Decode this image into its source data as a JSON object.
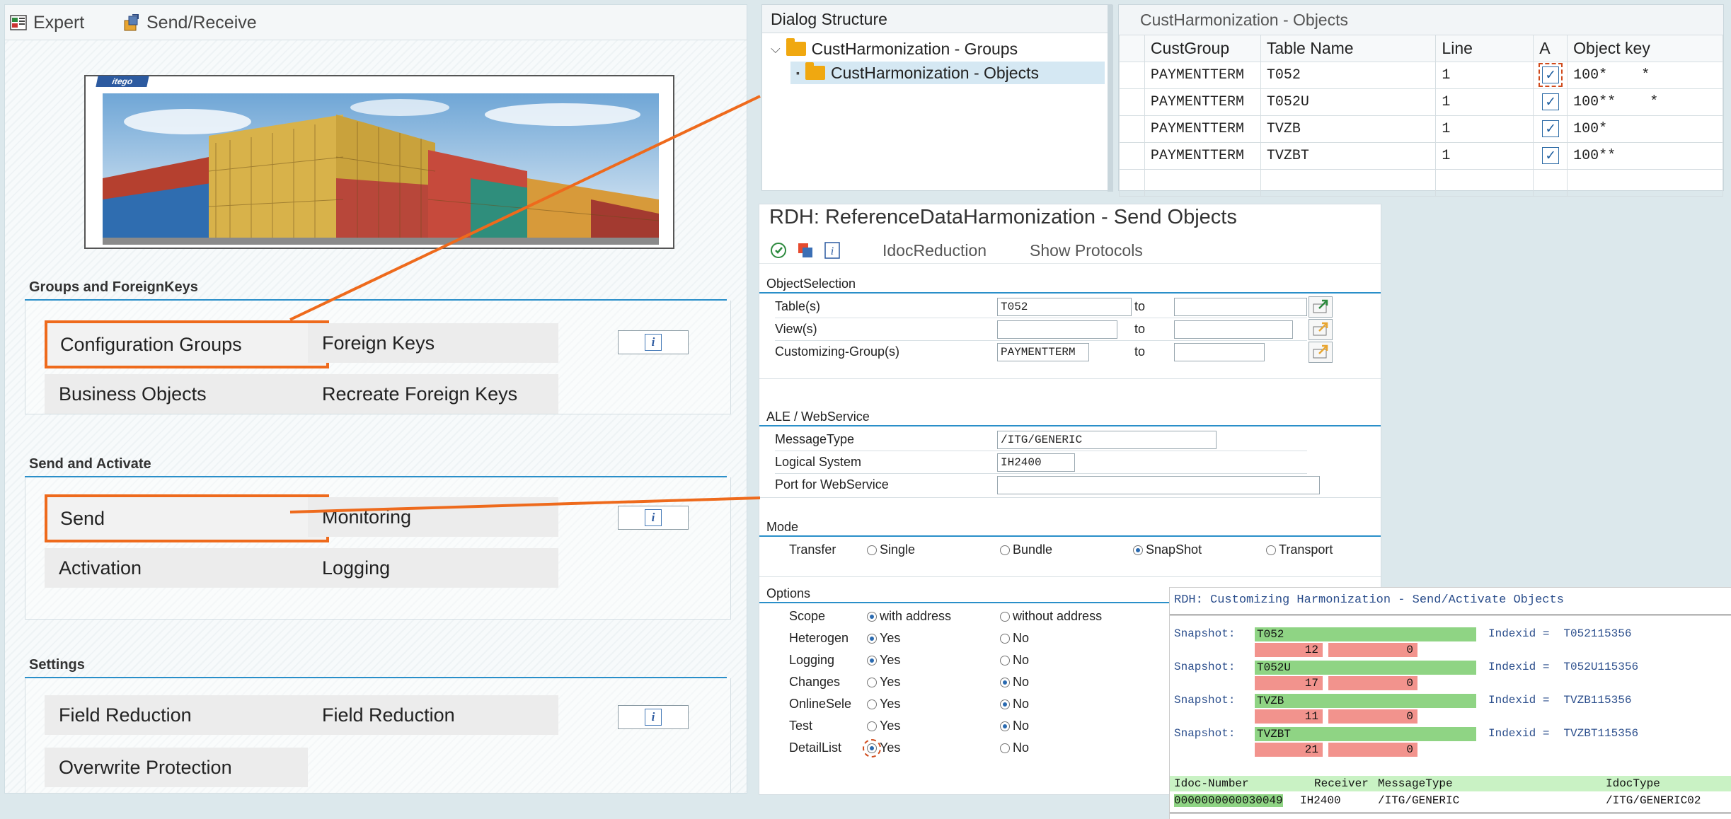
{
  "left_toolbar": {
    "expert": "Expert",
    "send_receive": "Send/Receive"
  },
  "banner": {
    "logo": "itego"
  },
  "groups_section": {
    "title": "Groups and ForeignKeys",
    "tiles": [
      "Configuration Groups",
      "Foreign Keys",
      "Business Objects",
      "Recreate Foreign Keys"
    ],
    "info": "i"
  },
  "send_section": {
    "title": "Send and Activate",
    "tiles": [
      "Send",
      "Monitoring",
      "Activation",
      "Logging"
    ],
    "info": "i"
  },
  "settings_section": {
    "title": "Settings",
    "tiles": [
      "Field Reduction",
      "Field Reduction",
      "Overwrite Protection"
    ],
    "info": "i"
  },
  "dialog_structure": {
    "title": "Dialog Structure",
    "items": [
      "CustHarmonization - Groups",
      "CustHarmonization - Objects"
    ]
  },
  "objects_table": {
    "title": "CustHarmonization - Objects",
    "columns": [
      "CustGroup",
      "Table Name",
      "Line",
      "A",
      "Object key"
    ],
    "rows": [
      {
        "group": "PAYMENTTERM",
        "table": "T052",
        "line": "1",
        "a": "✓",
        "key": "100*    *"
      },
      {
        "group": "PAYMENTTERM",
        "table": "T052U",
        "line": "1",
        "a": "✓",
        "key": "100**    *"
      },
      {
        "group": "PAYMENTTERM",
        "table": "TVZB",
        "line": "1",
        "a": "✓",
        "key": "100*"
      },
      {
        "group": "PAYMENTTERM",
        "table": "TVZBT",
        "line": "1",
        "a": "✓",
        "key": "100**"
      }
    ]
  },
  "rdh": {
    "title": "RDH: ReferenceDataHarmonization - Send Objects",
    "toolbar": {
      "idoc_reduction": "IdocReduction",
      "show_protocols": "Show Protocols"
    },
    "object_selection": {
      "title": "ObjectSelection",
      "to": "to",
      "rows": [
        {
          "label": "Table(s)",
          "value": "T052"
        },
        {
          "label": "View(s)",
          "value": ""
        },
        {
          "label": "Customizing-Group(s)",
          "value": "PAYMENTTERM"
        }
      ]
    },
    "ale": {
      "title": "ALE / WebService",
      "rows": [
        {
          "label": "MessageType",
          "value": "/ITG/GENERIC"
        },
        {
          "label": "Logical System",
          "value": "IH2400"
        },
        {
          "label": "Port for WebService",
          "value": ""
        }
      ]
    },
    "mode": {
      "title": "Mode",
      "label": "Transfer",
      "options": [
        "Single",
        "Bundle",
        "SnapShot",
        "Transport"
      ],
      "selected": "SnapShot"
    },
    "options": {
      "title": "Options",
      "rows": [
        {
          "label": "Scope",
          "a": "with address",
          "b": "without address",
          "sel": "a"
        },
        {
          "label": "Heterogen",
          "a": "Yes",
          "b": "No",
          "sel": "a"
        },
        {
          "label": "Logging",
          "a": "Yes",
          "b": "No",
          "sel": "a"
        },
        {
          "label": "Changes",
          "a": "Yes",
          "b": "No",
          "sel": "b"
        },
        {
          "label": "OnlineSele",
          "a": "Yes",
          "b": "No",
          "sel": "b"
        },
        {
          "label": "Test",
          "a": "Yes",
          "b": "No",
          "sel": "b"
        },
        {
          "label": "DetailList",
          "a": "Yes",
          "b": "No",
          "sel": "a"
        }
      ]
    }
  },
  "protocol": {
    "title": "RDH: Customizing Harmonization - Send/Activate Objects",
    "snap_label": "Snapshot:",
    "index_label": "Indexid =",
    "snapshots": [
      {
        "table": "T052",
        "count": "12",
        "errors": "0",
        "indexid": "T052115356"
      },
      {
        "table": "T052U",
        "count": "17",
        "errors": "0",
        "indexid": "T052U115356"
      },
      {
        "table": "TVZB",
        "count": "11",
        "errors": "0",
        "indexid": "TVZB115356"
      },
      {
        "table": "TVZBT",
        "count": "21",
        "errors": "0",
        "indexid": "TVZBT115356"
      }
    ],
    "idoc_headers": [
      "Idoc-Number",
      "Receiver",
      "MessageType",
      "IdocType"
    ],
    "idoc_row": [
      "0000000000030049",
      "IH2400",
      "/ITG/GENERIC",
      "/ITG/GENERIC02"
    ]
  },
  "colors": {
    "highlight": "#ee6a1c",
    "section_line": "#2a8fc9",
    "snapshot_ok": "#8fd484",
    "snapshot_err": "#f2938d"
  }
}
